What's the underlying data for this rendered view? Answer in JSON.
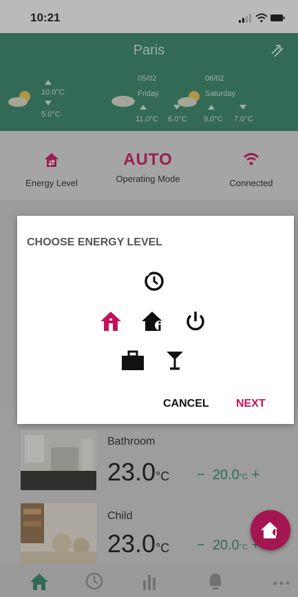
{
  "status_bar": {
    "time": "10:21"
  },
  "weather": {
    "city": "Paris",
    "today": {
      "max": "10.0°C",
      "min": "5.0°C"
    },
    "forecast": [
      {
        "date": "05/02",
        "day": "Friday",
        "max": "11.0°C",
        "min": "6.0°C"
      },
      {
        "date": "06/02",
        "day": "Saturday",
        "max": "9.0°C",
        "min": "7.0°C"
      }
    ]
  },
  "status": {
    "energy_label": "Energy Level",
    "mode_value": "AUTO",
    "mode_label": "Operating Mode",
    "connection_label": "Connected"
  },
  "dialog": {
    "title": "CHOOSE ENERGY LEVEL",
    "cancel_label": "CANCEL",
    "next_label": "NEXT",
    "options": [
      "clock-icon",
      "home-icon",
      "home-info-icon",
      "power-icon",
      "briefcase-icon",
      "cocktail-icon"
    ]
  },
  "rooms": [
    {
      "name": "Bathroom",
      "temp": "23.0",
      "unit": "°C",
      "setpoint": "20.0",
      "set_unit": "°C"
    },
    {
      "name": "Child",
      "temp": "23.0",
      "unit": "°C",
      "setpoint": "20.0",
      "set_unit": "°C"
    }
  ],
  "colors": {
    "accent": "#c4125a",
    "green": "#2e8062"
  }
}
